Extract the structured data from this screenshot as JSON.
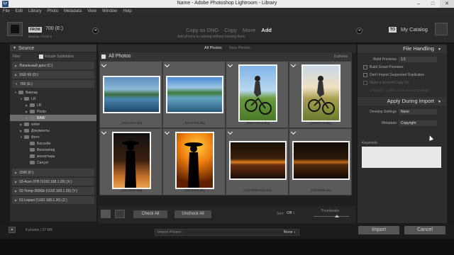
{
  "window": {
    "title": "Name - Adobe Photoshop Lightroom - Library"
  },
  "menu": [
    "File",
    "Edit",
    "Library",
    "Photo",
    "Metadata",
    "View",
    "Window",
    "Help"
  ],
  "header": {
    "from_label": "FROM",
    "from_source": "700 (E:)",
    "from_sub": "Вивлар / RAW ▾",
    "modes": [
      "Copy as DNG",
      "Copy",
      "Move",
      "Add"
    ],
    "active_mode": "Add",
    "mode_description": "Add photos to catalog without moving them",
    "to_label": "TO",
    "to_dest": "My Catalog"
  },
  "source_panel": {
    "title": "Source",
    "files_label": "Files",
    "include_subfolders": "Include Subfolders",
    "drives_top": [
      "Локальный диск (C:)",
      "SSD 60 (D:)",
      "700 (E:)"
    ],
    "folders": [
      {
        "label": "Вивлар",
        "depth": 0
      },
      {
        "label": "LR",
        "depth": 1
      },
      {
        "label": "LR",
        "depth": 2
      },
      {
        "label": "Photo",
        "depth": 2
      },
      {
        "label": "RAW",
        "depth": 2,
        "selected": true
      },
      {
        "label": "writer",
        "depth": 1
      },
      {
        "label": "Документы",
        "depth": 1
      },
      {
        "label": "Фото",
        "depth": 1
      },
      {
        "label": "Бассейн",
        "depth": 2
      },
      {
        "label": "Велосипед",
        "depth": 2
      },
      {
        "label": "монастырь",
        "depth": 2
      },
      {
        "label": "Силуэт",
        "depth": 2
      }
    ],
    "drives_bottom": [
      "1500 (F:)",
      "03-Acer-3TB (\\\\192.168.1.26) (X:)",
      "02-Temp-300Gb (\\\\192.168.1.26) (Y:)",
      "01-Lepsei (\\\\192.168.1.26) (Z:)"
    ]
  },
  "grid": {
    "tabs": [
      "All Photos",
      "New Photos"
    ],
    "header": "All Photos",
    "count": "8 photos",
    "photos": [
      {
        "name": "_DSC4408.dng",
        "scene": "pool"
      },
      {
        "name": "_DSC4409.dng",
        "scene": "pool"
      },
      {
        "name": "_DSC2712-3.dng",
        "scene": "bike"
      },
      {
        "name": "_DSC2712.dng",
        "scene": "bike"
      },
      {
        "name": "_DSC3465.dng",
        "scene": "silhouette"
      },
      {
        "name": "_DSC3465.dng",
        "scene": "silhouette-gold"
      },
      {
        "name": "_DSC0099-Edit.dng",
        "scene": "night"
      },
      {
        "name": "_DSC0099.dng",
        "scene": "night"
      }
    ],
    "check_all": "Check All",
    "uncheck_all": "Uncheck All",
    "sort_label": "Sort:",
    "sort_value": "Off ↕",
    "thumbnails_label": "Thumbnails"
  },
  "file_handling": {
    "title": "File Handling",
    "build_previews_label": "Build Previews",
    "build_previews_value": "1:1",
    "build_smart": "Build Smart Previews",
    "dont_import_dupes": "Don't Import Suspected Duplicates",
    "second_copy": "Make a Second Copy To:",
    "second_copy_path": "C:\\Users\\...\\Lightroom\\Download Backups"
  },
  "apply": {
    "title": "Apply During Import",
    "develop_label": "Develop Settings",
    "develop_value": "None",
    "metadata_label": "Metadata",
    "metadata_value": "Copyright",
    "keywords_label": "Keywords"
  },
  "footer": {
    "summary": "8 photos / 27 MB",
    "preset_label": "Import Preset :",
    "preset_value": "None ↕",
    "import": "Import",
    "cancel": "Cancel"
  }
}
